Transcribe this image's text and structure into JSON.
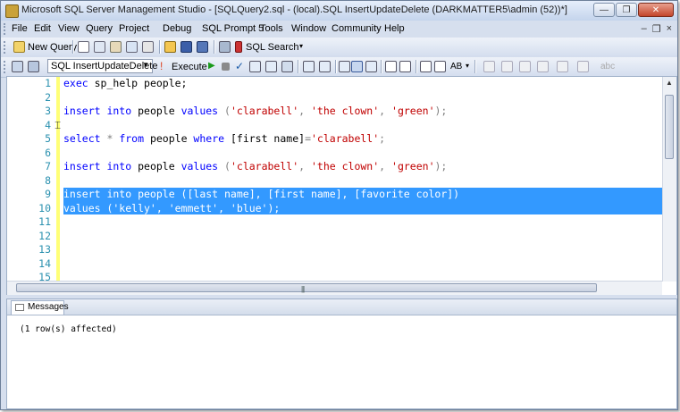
{
  "window": {
    "title": "Microsoft SQL Server Management Studio - [SQLQuery2.sql - (local).SQL InsertUpdateDelete (DARKMATTER5\\admin (52))*]"
  },
  "window_controls": {
    "minimize": "—",
    "restore": "❐",
    "close": "✕"
  },
  "menu": [
    "File",
    "Edit",
    "View",
    "Query",
    "Project",
    "Debug",
    "SQL Prompt 5",
    "Tools",
    "Window",
    "Community",
    "Help"
  ],
  "mdi_controls": {
    "minimize": "–",
    "restore": "❐",
    "close": "×"
  },
  "toolbar1": {
    "new_query": "New Query",
    "sql_search": "SQL Search"
  },
  "toolbar2": {
    "database": "SQL InsertUpdateDelete",
    "execute": "Execute",
    "abc_button": "abc",
    "ab_label": "AB"
  },
  "editor": {
    "line_numbers": [
      "1",
      "2",
      "3",
      "4",
      "5",
      "6",
      "7",
      "8",
      "9",
      "10",
      "11",
      "12",
      "13",
      "14",
      "15"
    ],
    "lines": {
      "l1": {
        "kw1": "exec",
        "rest": " sp_help people;"
      },
      "l3": {
        "kw1": "insert into",
        "mid": " people ",
        "kw2": "values",
        "p1": " (",
        "s1": "'clarabell'",
        "c1": ", ",
        "s2": "'the clown'",
        "c2": ", ",
        "s3": "'green'",
        "p2": ");"
      },
      "l5": {
        "kw1": "select",
        "op1": " * ",
        "kw2": "from",
        "mid": " people ",
        "kw3": "where",
        "rest": " [first name]",
        "op2": "=",
        "s1": "'clarabell'",
        "end": ";"
      },
      "l7": {
        "kw1": "insert into",
        "mid": " people ",
        "kw2": "values",
        "p1": " (",
        "s1": "'clarabell'",
        "c1": ", ",
        "s2": "'the clown'",
        "c2": ", ",
        "s3": "'green'",
        "p2": ");"
      },
      "l9": "insert into people ([last name], [first name], [favorite color])",
      "l10": "values ('kelly', 'emmett', 'blue');"
    }
  },
  "messages": {
    "tab_label": "Messages",
    "output": "(1 row(s) affected)"
  },
  "colors": {
    "keyword": "#0000ff",
    "string": "#c00000",
    "operator": "#7f7f7f",
    "selection": "#3399ff",
    "line_number": "#2b91af"
  }
}
